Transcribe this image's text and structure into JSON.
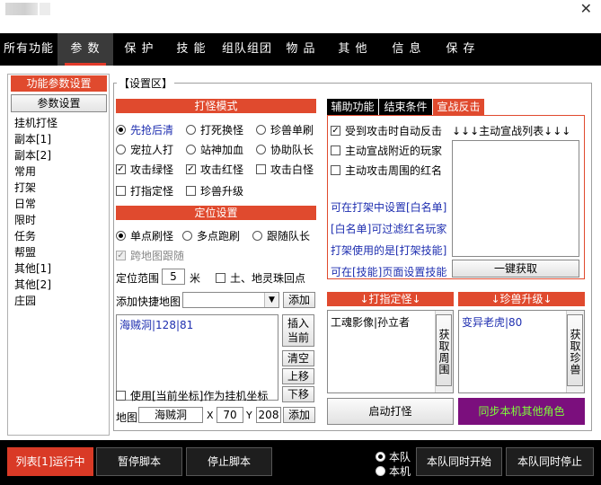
{
  "window": {
    "close_glyph": "✕"
  },
  "nav": {
    "tabs": [
      {
        "label": "所有功能"
      },
      {
        "label": "参 数"
      },
      {
        "label": "保 护"
      },
      {
        "label": "技 能"
      },
      {
        "label": "组队组团"
      },
      {
        "label": "物 品"
      },
      {
        "label": "其 他"
      },
      {
        "label": "信 息"
      },
      {
        "label": "保 存"
      }
    ],
    "active_index": 1
  },
  "left": {
    "header": "功能参数设置",
    "settings_button": "参数设置",
    "items": [
      "挂机打怪",
      "副本[1]",
      "副本[2]",
      "常用",
      "打架",
      "日常",
      "限时",
      "任务",
      "帮盟",
      "其他[1]",
      "其他[2]",
      "庄园"
    ]
  },
  "settings": {
    "group_label": "【设置区】",
    "attack_mode": {
      "title": "打怪模式",
      "options": {
        "first_come": "先抢后清",
        "kill_switch": "打死换怪",
        "rare_single": "珍兽单刷",
        "pet_attack": "宠拉人打",
        "stand_hit": "站神加血",
        "assist_leader": "协助队长"
      },
      "checks": {
        "green": "攻击绿怪",
        "red": "攻击红怪",
        "white": "攻击白怪",
        "fixed": "打指定怪",
        "pet_upgrade": "珍兽升级"
      }
    },
    "position": {
      "title": "定位设置",
      "options": {
        "single": "单点刷怪",
        "multi": "多点跑刷",
        "follow": "跟随队长"
      },
      "cross_map": "跨地图跟随",
      "range_label": "定位范围",
      "range_value": "5",
      "range_unit": "米",
      "earth_return": "土、地灵珠回点",
      "shortcut_label": "添加快捷地图",
      "add_button": "添加",
      "list_items": [
        "海贼洞|128|81"
      ],
      "insert_current": "插入当前",
      "clear": "清空",
      "up": "上移",
      "down": "下移",
      "use_current": "使用[当前坐标]作为挂机坐标",
      "map_label": "地图",
      "map_value": "海贼洞",
      "x_label": "X",
      "x_value": "70",
      "y_label": "Y",
      "y_value": "208",
      "add_button2": "添加"
    },
    "right_tabs": [
      {
        "label": "辅助功能"
      },
      {
        "label": "结束条件"
      },
      {
        "label": "宣战反击"
      }
    ],
    "right_active": 2,
    "counter": {
      "auto_declare": "受到攻击时自动反击",
      "list_label": "↓↓↓主动宣战列表↓↓↓",
      "declare_nearby": "主动宣战附近的玩家",
      "attack_red": "主动攻击周围的红名",
      "notes": [
        "可在打架中设置[白名单]",
        "[白名单]可过滤红名玩家",
        "打架使用的是[打架技能]",
        "可在[技能]页面设置技能"
      ],
      "one_key": "一键获取"
    },
    "fixed_monster": {
      "title": "↓打指定怪↓",
      "items": [
        "工魂影像|孙立者"
      ],
      "get_around": "获取周围"
    },
    "pet_upgrade": {
      "title": "↓珍兽升级↓",
      "items": [
        "变异老虎|80"
      ],
      "get_pet": "获取珍兽"
    },
    "start_button": "启动打怪",
    "sync_button": "同步本机其他角色"
  },
  "bottom": {
    "run_button": "列表[1]运行中",
    "pause_button": "暂停脚本",
    "stop_button": "停止脚本",
    "radio_team": "本队",
    "radio_local": "本机",
    "team_start": "本队同时开始",
    "team_stop": "本队同时停止"
  },
  "colors": {
    "accent": "#e04a2e",
    "sync_bg": "#7b0f7d",
    "sync_text": "#7fff3a",
    "link_blue": "#1f2fb0"
  }
}
